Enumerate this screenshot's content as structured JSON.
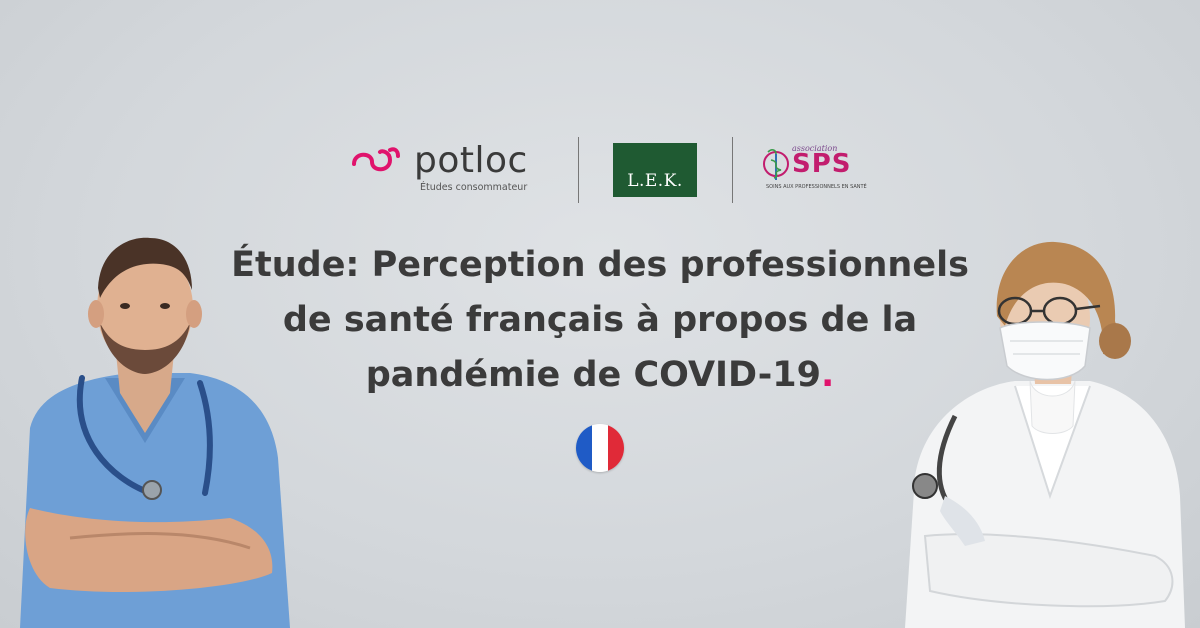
{
  "logos": {
    "potloc": {
      "name": "potloc",
      "tagline": "Études consommateur",
      "color": "#e0136c"
    },
    "lek": {
      "name": "L.E.K.",
      "color": "#1f5a32"
    },
    "sps": {
      "association": "association",
      "name": "SPS",
      "subtitle": "SOINS AUX PROFESSIONNELS EN SANTÉ",
      "color": "#c21d6e"
    }
  },
  "title": {
    "line1": "Étude: Perception des professionnels",
    "line2": "de santé français à propos de la",
    "line3": "pandémie de COVID-19",
    "accent_dot": ".",
    "accent_color": "#e0136c"
  },
  "flag": {
    "icon": "france-flag-icon",
    "colors": [
      "#1f5bc6",
      "#ffffff",
      "#e02a38"
    ]
  },
  "people": {
    "left": "male-doctor-with-stethoscope",
    "right": "female-doctor-with-mask"
  }
}
